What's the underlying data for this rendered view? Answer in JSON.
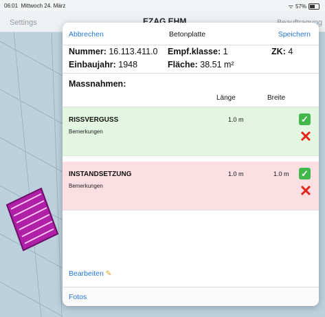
{
  "status_bar": {
    "time": "06:01",
    "date": "Mittwoch 24. März",
    "battery": "57%"
  },
  "navbar": {
    "left": "Settings",
    "title": "EZAG EHM",
    "right": "Beauftragung"
  },
  "sheet": {
    "cancel": "Abbrechen",
    "title": "Betonplatte",
    "save": "Speichern",
    "info": {
      "nummer_label": "Nummer:",
      "nummer_value": "16.113.411.0",
      "empf_label": "Empf.klasse:",
      "empf_value": "1",
      "zk_label": "ZK:",
      "zk_value": "4",
      "einbau_label": "Einbaujahr:",
      "einbau_value": "1948",
      "flaeche_label": "Fläche:",
      "flaeche_value": "38.51 m²"
    },
    "massnahmen": {
      "title": "Massnahmen:",
      "col_length": "Länge",
      "col_width": "Breite",
      "items": [
        {
          "name": "RISSVERGUSS",
          "remark": "Bemerkungen",
          "length": "1.0 m",
          "width": "",
          "color": "#e3f6e1"
        },
        {
          "name": "INSTANDSETZUNG",
          "remark": "Bemerkungen",
          "length": "1.0 m",
          "width": "1.0 m",
          "color": "#fbdfe3"
        }
      ]
    },
    "edit": "Bearbeiten",
    "photos": "Fotos"
  },
  "icons": {
    "check": "check-icon",
    "delete": "cross-icon",
    "edit": "pencil-icon"
  },
  "colors": {
    "accent": "#1f76d2",
    "success": "#42b84b",
    "danger": "#e2241b",
    "selection": "#b01fa8"
  }
}
